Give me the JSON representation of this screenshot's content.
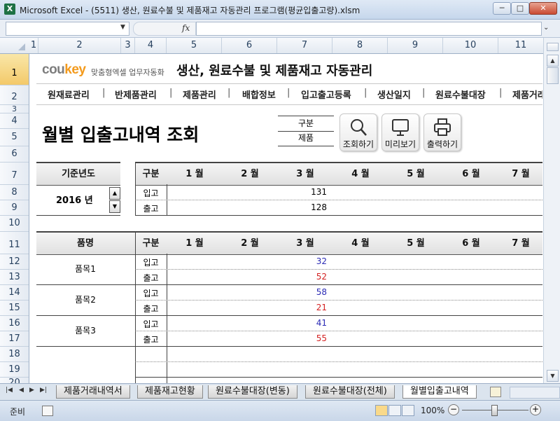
{
  "window": {
    "title": "Microsoft Excel - (5511) 생산, 원료수불 및 제품재고 자동관리 프로그램(평균입출고량).xlsm",
    "app_icon": "X",
    "minimize": "─",
    "maximize": "□",
    "close": "✕"
  },
  "formula_bar": {
    "fx": "fx",
    "name_box_value": "",
    "formula_value": ""
  },
  "columns": [
    "1",
    "2",
    "3",
    "4",
    "5",
    "6",
    "7",
    "8",
    "9",
    "10",
    "11"
  ],
  "rows": [
    "1",
    "2",
    "3",
    "4",
    "5",
    "6",
    "7",
    "8",
    "9",
    "10",
    "11",
    "12",
    "13",
    "14",
    "15",
    "16",
    "17",
    "18",
    "19",
    "20"
  ],
  "header": {
    "logo_main": "cou",
    "logo_accent": "key",
    "logo_sub": "맞춤형엑셀 업무자동화",
    "app_title": "생산, 원료수불 및 제품재고 자동관리"
  },
  "nav": {
    "items": [
      "원재료관리",
      "반제품관리",
      "제품관리",
      "배합정보",
      "입고출고등록",
      "생산일지",
      "원료수불대장",
      "제품거래"
    ],
    "separator": "|"
  },
  "page": {
    "title": "월별 입출고내역 조회",
    "gubun_label": "구분",
    "gubun_value": "제품"
  },
  "tools": {
    "search": "조회하기",
    "preview": "미리보기",
    "print": "출력하기"
  },
  "year_panel": {
    "header": "기준년도",
    "value": "2016 년",
    "up": "▲",
    "down": "▼"
  },
  "summary": {
    "headers": [
      "구분",
      "1 월",
      "2 월",
      "3 월",
      "4 월",
      "5 월",
      "6 월",
      "7 월"
    ],
    "rows": [
      {
        "label": "입고",
        "values": [
          "",
          "",
          "131",
          "",
          "",
          "",
          ""
        ]
      },
      {
        "label": "출고",
        "values": [
          "",
          "",
          "128",
          "",
          "",
          "",
          ""
        ]
      }
    ]
  },
  "detail": {
    "headers": [
      "품명",
      "구분",
      "1 월",
      "2 월",
      "3 월",
      "4 월",
      "5 월",
      "6 월",
      "7 월"
    ],
    "items": [
      {
        "name": "품목1",
        "in_label": "입고",
        "out_label": "출고",
        "in_values": [
          "",
          "",
          "32",
          "",
          "",
          "",
          ""
        ],
        "out_values": [
          "",
          "",
          "52",
          "",
          "",
          "",
          ""
        ]
      },
      {
        "name": "품목2",
        "in_label": "입고",
        "out_label": "출고",
        "in_values": [
          "",
          "",
          "58",
          "",
          "",
          "",
          ""
        ],
        "out_values": [
          "",
          "",
          "21",
          "",
          "",
          "",
          ""
        ]
      },
      {
        "name": "품목3",
        "in_label": "입고",
        "out_label": "출고",
        "in_values": [
          "",
          "",
          "41",
          "",
          "",
          "",
          ""
        ],
        "out_values": [
          "",
          "",
          "55",
          "",
          "",
          "",
          ""
        ]
      }
    ],
    "in_color": "#2b2bb5",
    "out_color": "#d42222"
  },
  "sheet_tabs": [
    "제품거래내역서",
    "제품재고현황",
    "원료수불대장(변동)",
    "원료수불대장(전체)",
    "월별입출고내역"
  ],
  "active_tab": "월별입출고내역",
  "tab_nav": [
    "|◀",
    "◀",
    "▶",
    "▶|"
  ],
  "status": {
    "ready": "준비",
    "zoom": "100%",
    "zoom_minus": "−",
    "zoom_plus": "+"
  }
}
